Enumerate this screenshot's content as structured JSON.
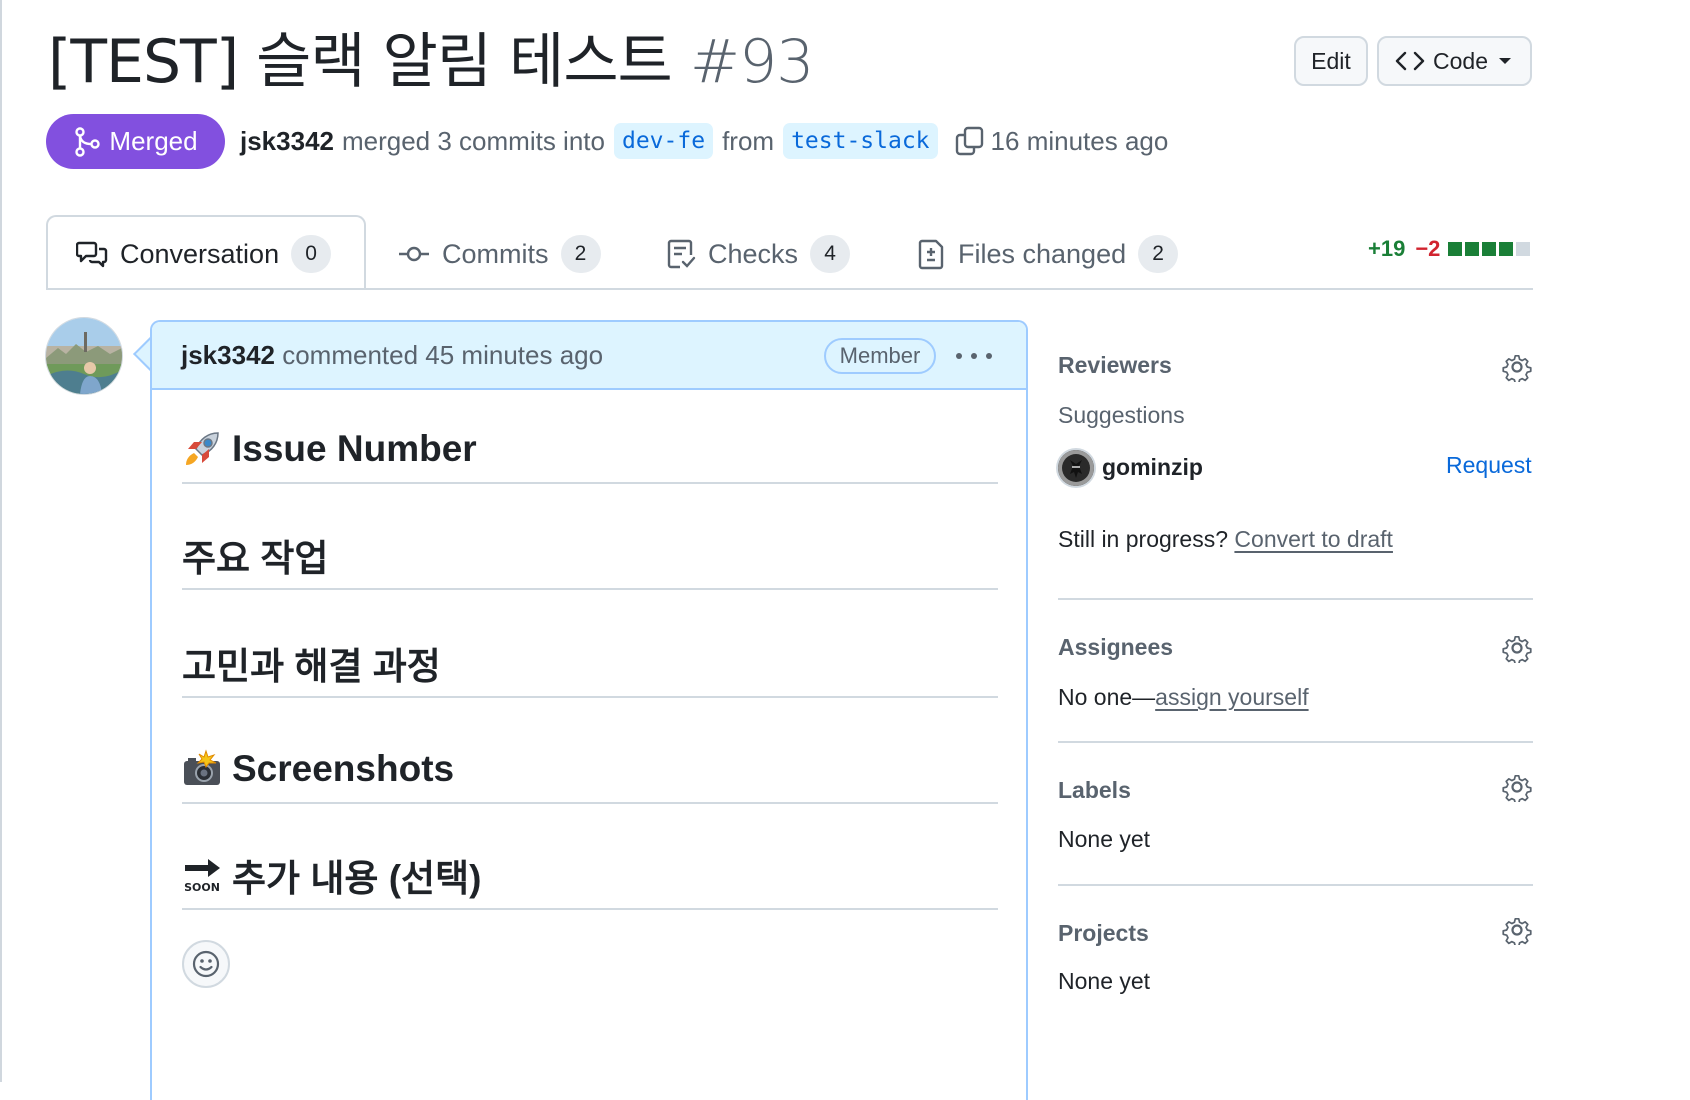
{
  "header": {
    "title_text": "[TEST] 슬랙 알림 테스트",
    "number": "#93",
    "edit_label": "Edit",
    "code_label": "Code"
  },
  "status": {
    "badge": "Merged",
    "author": "jsk3342",
    "action": "merged 3 commits into",
    "base_branch": "dev-fe",
    "from": "from",
    "head_branch": "test-slack",
    "time": "16 minutes ago"
  },
  "tabs": [
    {
      "label": "Conversation",
      "count": "0",
      "icon": "comment-discussion-icon"
    },
    {
      "label": "Commits",
      "count": "2",
      "icon": "git-commit-icon"
    },
    {
      "label": "Checks",
      "count": "4",
      "icon": "checklist-icon"
    },
    {
      "label": "Files changed",
      "count": "2",
      "icon": "file-diff-icon"
    }
  ],
  "diffstat": {
    "additions": "+19",
    "deletions": "−2",
    "blocks": [
      "#1a7f37",
      "#1a7f37",
      "#1a7f37",
      "#1a7f37",
      "#d1d9e0"
    ]
  },
  "comment": {
    "author": "jsk3342",
    "action": "commented 45 minutes ago",
    "role": "Member",
    "headings": [
      {
        "emoji": "rocket",
        "text": "Issue Number"
      },
      {
        "emoji": "",
        "text": "주요 작업"
      },
      {
        "emoji": "",
        "text": "고민과 해결 과정"
      },
      {
        "emoji": "camera-flash",
        "text": "Screenshots"
      },
      {
        "emoji": "soon-arrow",
        "text": "추가 내용 (선택)"
      }
    ],
    "soon_text": "SOON"
  },
  "sidebar": {
    "reviewers": {
      "title": "Reviewers",
      "suggestions_label": "Suggestions",
      "suggested_user": "gominzip",
      "request_label": "Request",
      "draft_prompt": "Still in progress?",
      "draft_link": "Convert to draft"
    },
    "assignees": {
      "title": "Assignees",
      "prefix": "No one—",
      "link": "assign yourself"
    },
    "labels": {
      "title": "Labels",
      "value": "None yet"
    },
    "projects": {
      "title": "Projects",
      "value": "None yet"
    }
  },
  "colors": {
    "merged": "#8250df",
    "link": "#0969da",
    "comment_header": "#ddf4ff",
    "comment_border": "#9ecbff"
  }
}
